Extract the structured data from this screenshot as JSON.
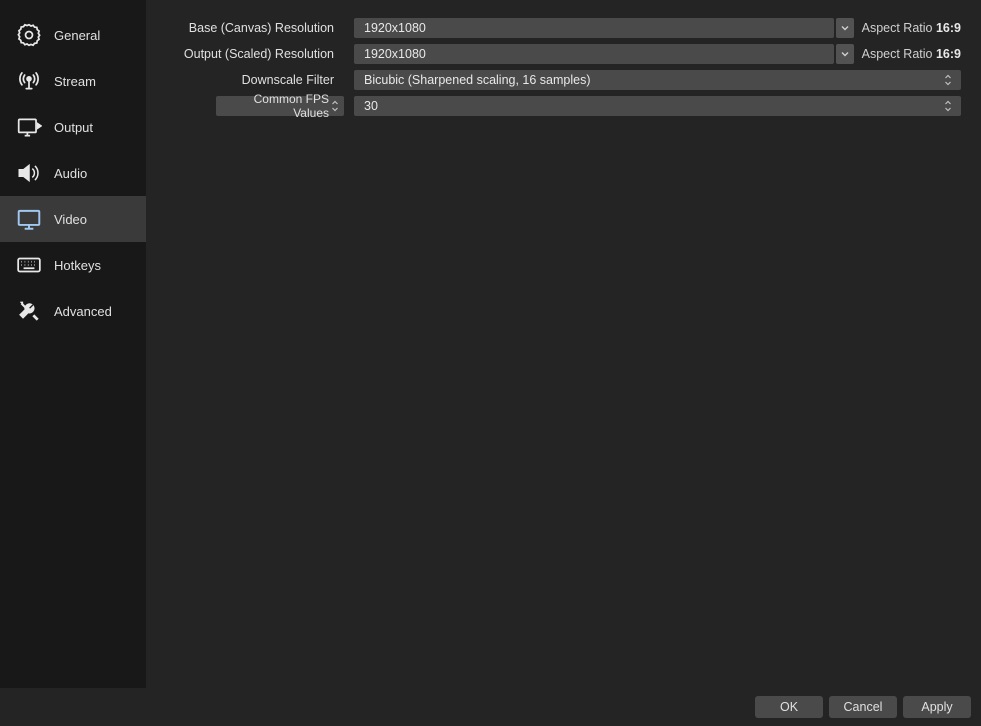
{
  "sidebar": {
    "items": [
      {
        "label": "General"
      },
      {
        "label": "Stream"
      },
      {
        "label": "Output"
      },
      {
        "label": "Audio"
      },
      {
        "label": "Video"
      },
      {
        "label": "Hotkeys"
      },
      {
        "label": "Advanced"
      }
    ]
  },
  "video": {
    "base_label": "Base (Canvas) Resolution",
    "base_value": "1920x1080",
    "base_aspect_label": "Aspect Ratio ",
    "base_aspect_value": "16:9",
    "output_label": "Output (Scaled) Resolution",
    "output_value": "1920x1080",
    "output_aspect_label": "Aspect Ratio ",
    "output_aspect_value": "16:9",
    "filter_label": "Downscale Filter",
    "filter_value": "Bicubic (Sharpened scaling, 16 samples)",
    "fps_label": "Common FPS Values",
    "fps_value": "30"
  },
  "footer": {
    "ok": "OK",
    "cancel": "Cancel",
    "apply": "Apply"
  }
}
